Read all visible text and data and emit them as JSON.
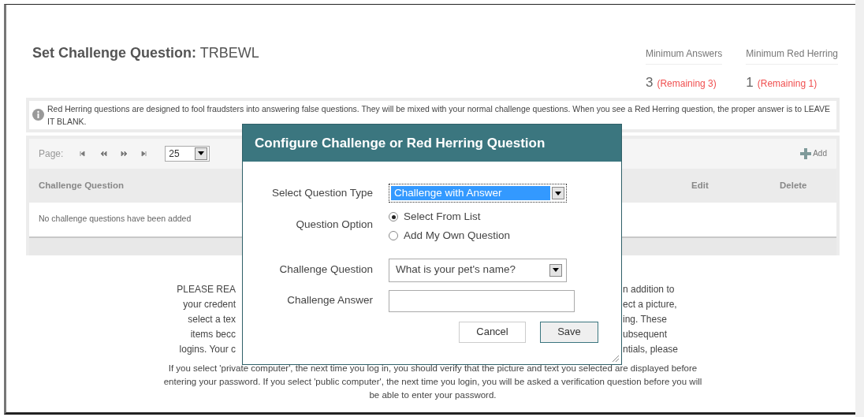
{
  "page": {
    "title": "Set Challenge Question:",
    "code": "TRBEWL"
  },
  "stats": [
    {
      "label": "Minimum Answers",
      "value": "3",
      "remaining": "(Remaining 3)"
    },
    {
      "label": "Minimum Red Herring",
      "value": "1",
      "remaining": "(Remaining 1)"
    }
  ],
  "info": "Red Herring questions are designed to fool fraudsters into answering false questions. They will be mixed with your normal challenge questions. When you see a Red Herring question, the proper answer is to LEAVE IT BLANK.",
  "pager": {
    "label": "Page:",
    "page_size": "25",
    "add": "Add"
  },
  "table": {
    "columns": [
      "Challenge Question",
      "Edit",
      "Delete"
    ],
    "empty": "No challenge questions have been added"
  },
  "notice": {
    "covered_lines": [
      {
        "left": "PLEASE REA",
        "right": "n addition to"
      },
      {
        "left": "your credent",
        "right": "ect a picture,"
      },
      {
        "left": "select a tex",
        "right": "ing. These"
      },
      {
        "left": "items becc",
        "right": "ubsequent"
      },
      {
        "left": "logins. Your c",
        "right": "ntials, please"
      }
    ],
    "paragraph": "If you select 'private computer', the next time you log in, you should verify that the picture and text you selected are displayed before entering your password. If you select 'public computer', the next time you login, you will be asked a verification question before you will be able to enter your password."
  },
  "dialog": {
    "title": "Configure Challenge or Red Herring Question",
    "type_label": "Select Question Type",
    "type_value": "Challenge with Answer",
    "option_label": "Question Option",
    "options": [
      {
        "label": "Select From List",
        "selected": true
      },
      {
        "label": "Add My Own Question",
        "selected": false
      }
    ],
    "question_label": "Challenge Question",
    "question_value": "What is your pet's name?",
    "answer_label": "Challenge Answer",
    "buttons": [
      "Cancel",
      "Save"
    ]
  }
}
